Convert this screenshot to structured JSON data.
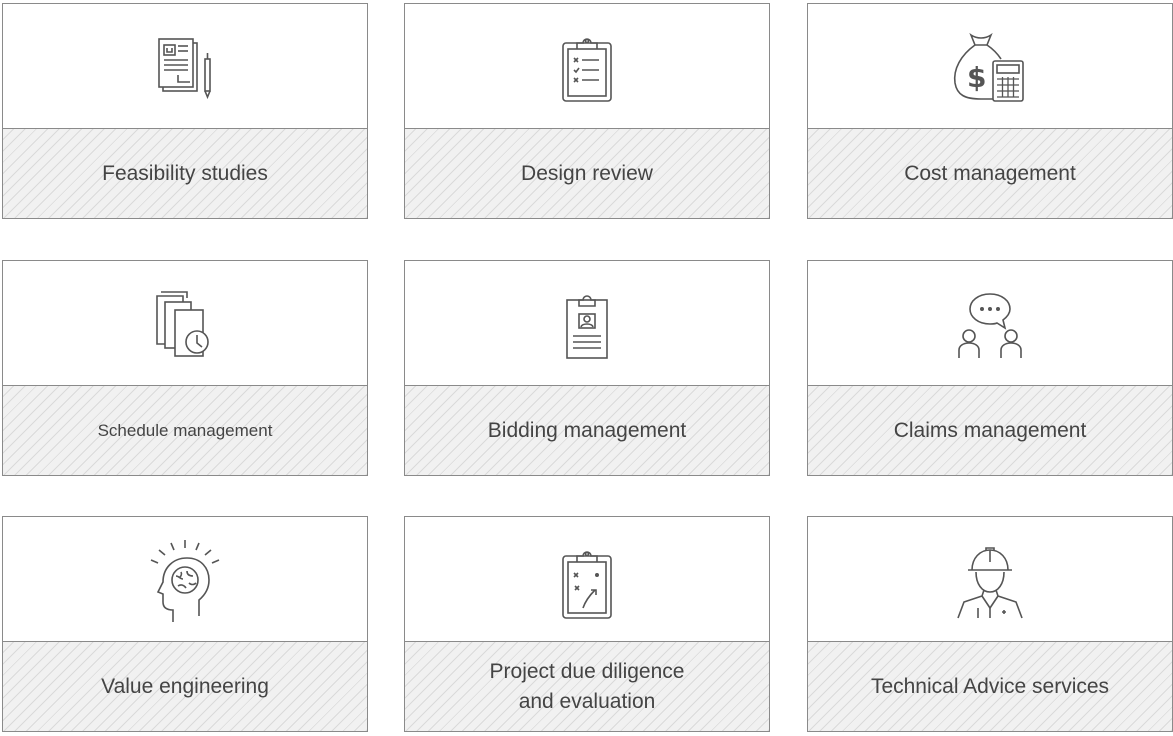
{
  "services": [
    {
      "label": "Feasibility studies",
      "icon": "document-pen-icon"
    },
    {
      "label": "Design review",
      "icon": "clipboard-checklist-icon"
    },
    {
      "label": "Cost management",
      "icon": "money-bag-calculator-icon"
    },
    {
      "label": "Schedule management",
      "icon": "documents-clock-icon"
    },
    {
      "label": "Bidding management",
      "icon": "clipboard-id-icon"
    },
    {
      "label": "Claims management",
      "icon": "people-speech-bubble-icon"
    },
    {
      "label": "Value engineering",
      "icon": "head-brain-icon"
    },
    {
      "label": "Project due diligence\nand evaluation",
      "icon": "clipboard-strategy-icon"
    },
    {
      "label": "Technical Advice services",
      "icon": "engineer-helmet-icon"
    }
  ],
  "colors": {
    "border": "#8a8a8a",
    "label_bg": "#f1f1f1",
    "text": "#444444",
    "icon_stroke": "#555555"
  }
}
